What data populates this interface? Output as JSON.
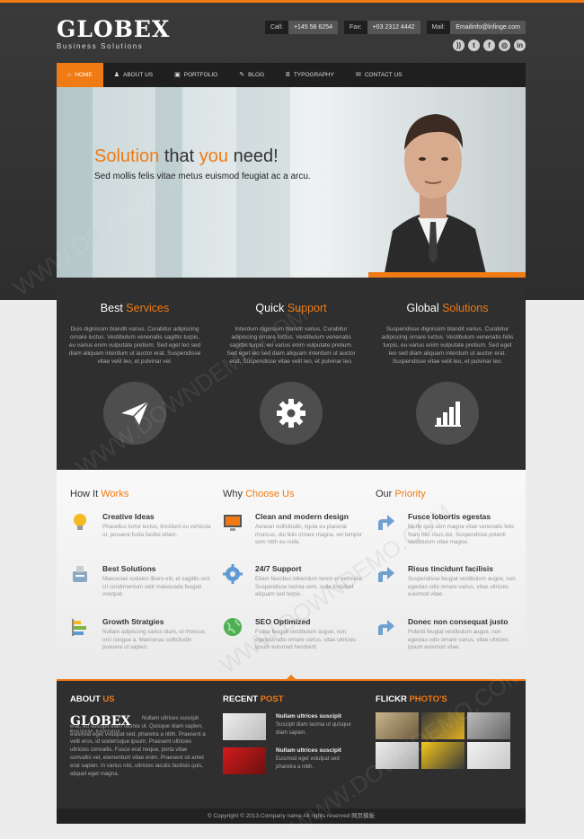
{
  "brand": {
    "name": "GLOBEX",
    "tagline": "Business Solutions"
  },
  "contact": [
    {
      "label": "Call:",
      "value": "+145 58 6254"
    },
    {
      "label": "Fax:",
      "value": "+03 2312 4442"
    },
    {
      "label": "Mail:",
      "value": "Emailinfo@lnfinge.com"
    }
  ],
  "nav": [
    {
      "label": "HOME",
      "icon": "home-icon",
      "glyph": "⌂"
    },
    {
      "label": "ABOUT US",
      "icon": "user-icon",
      "glyph": "♟"
    },
    {
      "label": "PORTFOLIO",
      "icon": "briefcase-icon",
      "glyph": "▣"
    },
    {
      "label": "BLOG",
      "icon": "pencil-icon",
      "glyph": "✎"
    },
    {
      "label": "TYPOGRAPHY",
      "icon": "bold-icon",
      "glyph": "B"
    },
    {
      "label": "CONTACT US",
      "icon": "mail-icon",
      "glyph": "✉"
    }
  ],
  "hero": {
    "title_a": "Solution",
    "title_b": " that ",
    "title_c": "you",
    "title_d": " need!",
    "subtitle": "Sed mollis felis vitae metus euismod feugiat ac a arcu."
  },
  "features": [
    {
      "title_a": "Best ",
      "title_b": "Services",
      "text": "Duis dignissim blandit varius. Curabitur adipiscing ornare luctus. Vestibulum venenatis sagittis turpis, eu varius enim vulputate pretium. Sed eget leo sed diam aliquam interdum ut auctor erat. Suspendisse vitae velit leo, et pulvinar vel."
    },
    {
      "title_a": "Quick ",
      "title_b": "Support",
      "text": "Interdum dignissim blandit varius. Curabitur adipiscing ornare luctus. Vestibulum venenatis sagittis turpis, eu varius enim vulputate pretium. Sed eget leo sed diam aliquam interdum ut auctor erat. Suspendisse vitae velit leo, et pulvinar leo."
    },
    {
      "title_a": "Global ",
      "title_b": "Solutions",
      "text": "Suspendisse dignissim blandit varius. Curabitur adipiscing ornare luctus. Vestibulum venenatis felis turpis, eu varius enim vulputate pretium. Sed eget leo sed diam aliquam interdum ut auctor erat. Suspendisse vitae velit leo, et pulvinar leo."
    }
  ],
  "columns": [
    {
      "title_a": "How It ",
      "title_b": "Works",
      "items": [
        {
          "title": "Creative Ideas",
          "text": "Phasellus tortor lectus, tincidunt eu vehicula ut, posuere fusfa facilisi etiam."
        },
        {
          "title": "Best Solutions",
          "text": "Maecenas sodales libero elit, et sagittis orci. Ut condimentum velit malesuada feugiat volutpat."
        },
        {
          "title": "Growth Stratgies",
          "text": "Nullam adipiscing varius diam, ut rhoncus orci congue a. Maecenas sollicitudin posuere ut sapien."
        }
      ]
    },
    {
      "title_a": "Why ",
      "title_b": "Choose Us",
      "items": [
        {
          "title": "Clean and modern design",
          "text": "Aenean sollicitudin, ligula eu placerat rhoncus, dui felis ornare magna, vel tempor sem nibh eu nulla."
        },
        {
          "title": "24/7 Support",
          "text": "Etiam faucibus bibendum lorem et vehicula. Suspendisse lacinia sem, nulla tincidunt aliquam sed turpis."
        },
        {
          "title": "SEO Optimized",
          "text": "Fusce feugiat vestibulum augue, non egestas odio ornare varius. vitae ultricies ipsum euismod hendrerit."
        }
      ]
    },
    {
      "title_a": "Our ",
      "title_b": "Priority",
      "items": [
        {
          "title": "Fusce lobortis egestas",
          "text": "Morbi quis sem magna vitae venenatis felis Nam nec risus dui. Suspendisse potenti Vestibulum vitae magna."
        },
        {
          "title": "Risus tincidunt facilisis",
          "text": "Suspendisse feugiat vestibulum augue, non egestas odio ornare varius. vitae ultricies euismod vitae."
        },
        {
          "title": "Donec non consequat justo",
          "text": "Potenti feugiat vestibulum augue, non egestas odio ornare varius. vitae ultricies ipsum euismod vitae."
        }
      ]
    }
  ],
  "footer": {
    "about_a": "ABOUT ",
    "about_b": "US",
    "about_text": "Nullam ultrices suscipit erat, eu suscipit diam lacinia ut. Quisque diam sapien, euismod eget volutpat sed, pharetra a nibh. Praesent a velit eros, id scelerisque ipsum. Praesent ultricies ultricies convallis. Fusce erat neque, porta vitae convallis vel, elementum vitae enim. Praesent sit amet erat sapien. In varius nisl, ultricies iaculis facilisis quis, aliquet eget magna.",
    "recent_a": "RECENT ",
    "recent_b": "POST",
    "posts": [
      {
        "title": "Nullam ultrices suscipit",
        "text": "Suscipit diam lacinia ut quisque diam sapien."
      },
      {
        "title": "Nullam ultrices suscipit",
        "text": "Euismod eget volutpat sed pharetra a nibh."
      }
    ],
    "flickr_a": "FLICKR ",
    "flickr_b": "PHOTO'S",
    "copyright": "© Copyright © 2013.Company name All rights reserved 网页模板"
  },
  "social": [
    "rss-icon",
    "twitter-icon",
    "facebook-icon",
    "dribbble-icon",
    "linkedin-icon"
  ],
  "colors": {
    "accent": "#f07a13",
    "dark": "#2f2f2f",
    "nav": "#1f1f1f"
  }
}
